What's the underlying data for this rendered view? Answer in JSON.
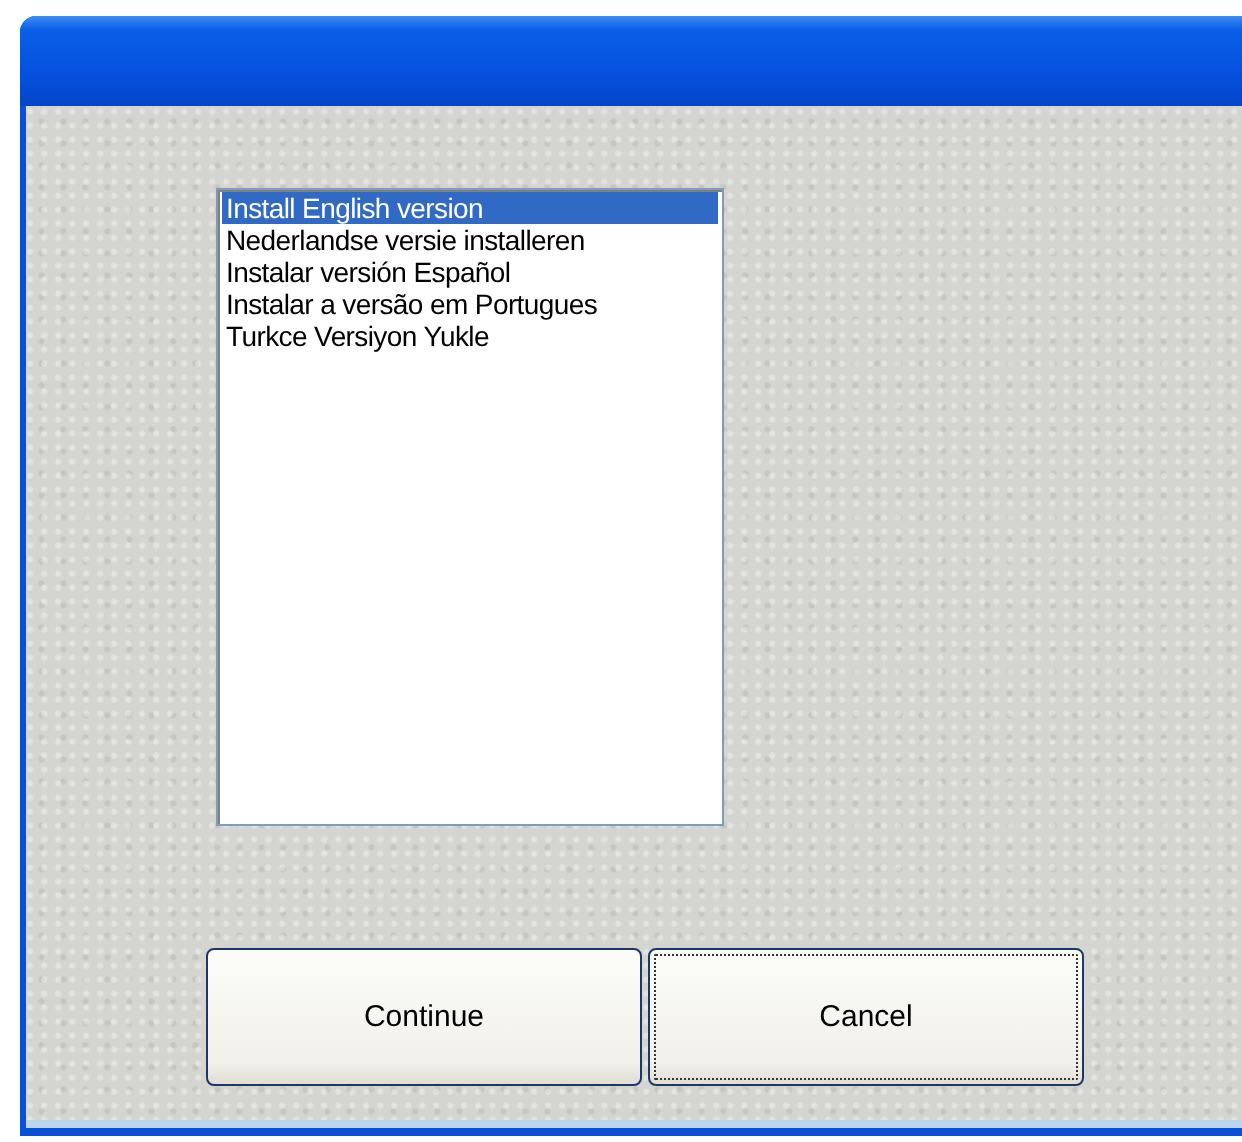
{
  "language_list": {
    "items": [
      {
        "label": "Install English version",
        "selected": true
      },
      {
        "label": "Nederlandse versie installeren",
        "selected": false
      },
      {
        "label": "Instalar versión Español",
        "selected": false
      },
      {
        "label": "Instalar a versão em Portugues",
        "selected": false
      },
      {
        "label": "Turkce Versiyon Yukle",
        "selected": false
      }
    ]
  },
  "buttons": [
    {
      "label": "Continue",
      "focused": false
    },
    {
      "label": "Cancel",
      "focused": true
    }
  ]
}
